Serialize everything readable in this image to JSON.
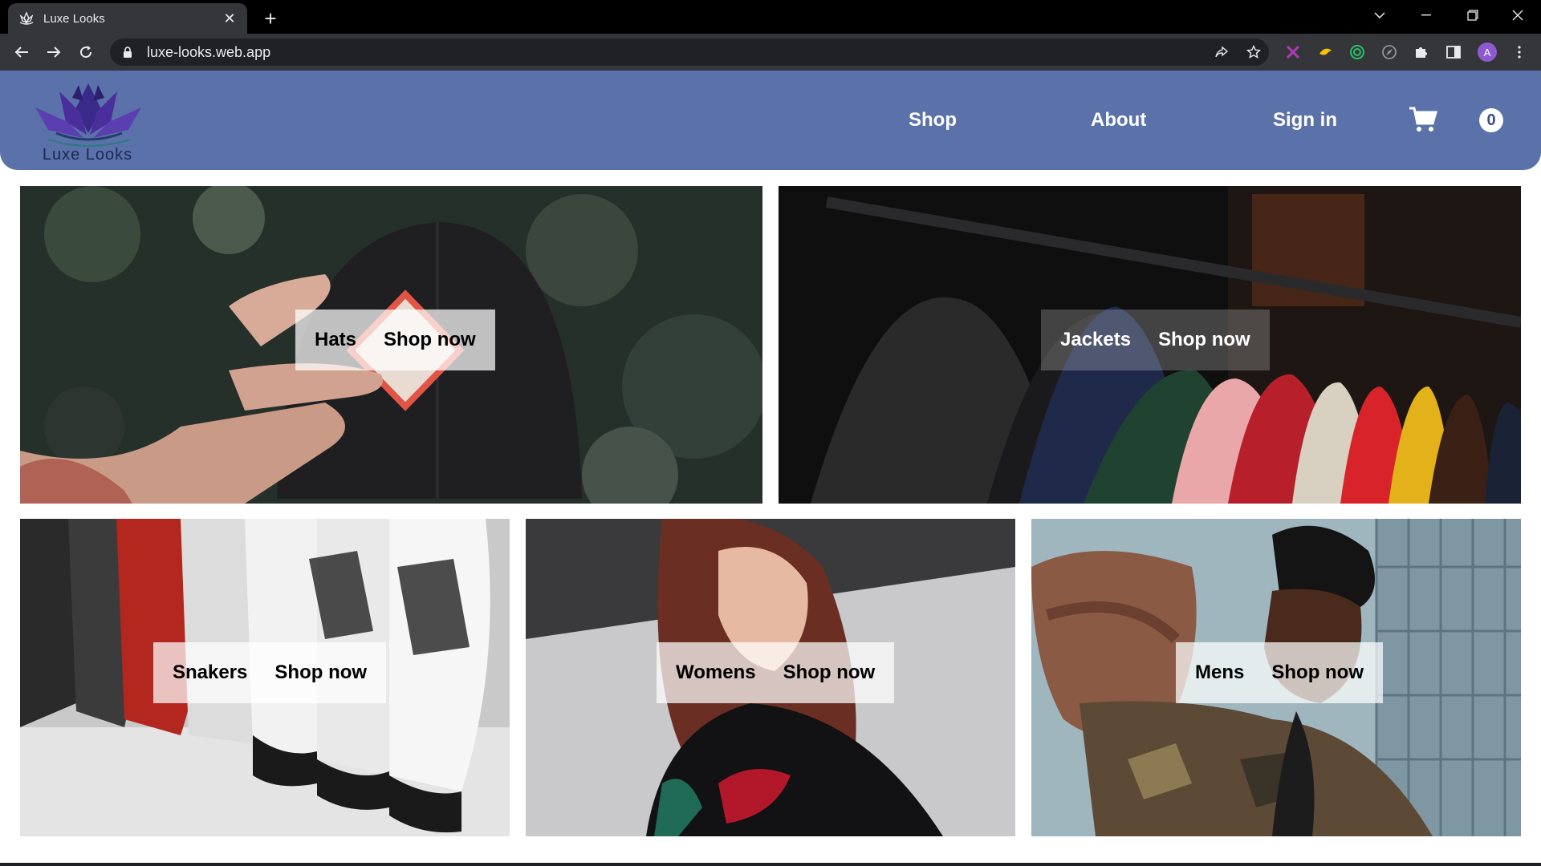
{
  "browser": {
    "tab_title": "Luxe Looks",
    "tab_close": "✕",
    "new_tab": "+",
    "url": "luxe-looks.web.app",
    "profile_initial": "A"
  },
  "header": {
    "logo_text": "Luxe Looks",
    "nav": {
      "shop": "Shop",
      "about": "About",
      "sign_in": "Sign in"
    },
    "cart_count": "0",
    "background_color": "#5a71a9"
  },
  "categories": [
    {
      "name": "Hats",
      "cta": "Shop now"
    },
    {
      "name": "Jackets",
      "cta": "Shop now"
    },
    {
      "name": "Snakers",
      "cta": "Shop now"
    },
    {
      "name": "Womens",
      "cta": "Shop now"
    },
    {
      "name": "Mens",
      "cta": "Shop now"
    }
  ]
}
